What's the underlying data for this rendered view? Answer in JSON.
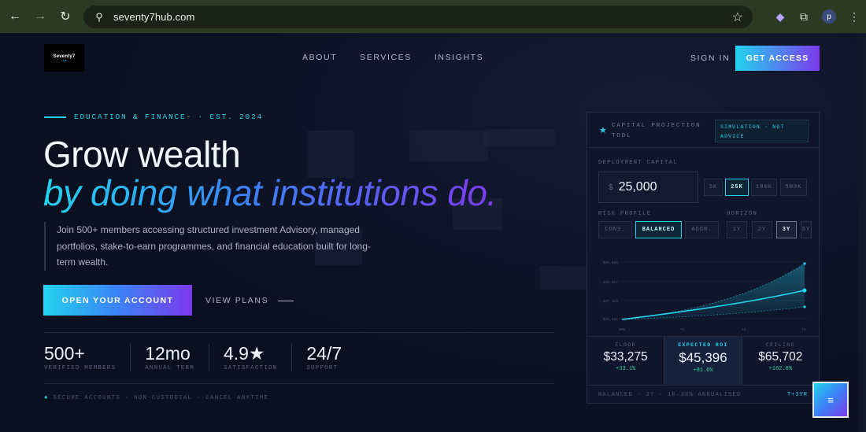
{
  "browser": {
    "url": "seventy7hub.com",
    "back_icon": "←",
    "forward_icon": "→",
    "reload_icon": "↻",
    "site_info_icon": "⚲",
    "bookmark_icon": "☆",
    "extension_icon": "◆",
    "puzzle_icon": "⧉",
    "profile_letter": "p",
    "menu_icon": "⋮"
  },
  "logo": {
    "text": "Seventy7",
    "sub": "HUB"
  },
  "nav": {
    "about": "ABOUT",
    "services": "SERVICES",
    "insights": "INSIGHTS",
    "sign_in": "SIGN IN",
    "get_access": "GET ACCESS"
  },
  "hero": {
    "eyebrow": "EDUCATION & FINANCE- · EST. 2024",
    "headline_1": "Grow wealth",
    "headline_2": "by doing what institutions do.",
    "lede": "Join 500+ members accessing structured investment Advisory, managed portfolios, stake-to-earn programmes, and financial education built for long-term wealth.",
    "cta": "OPEN YOUR ACCOUNT",
    "secondary": "VIEW PLANS"
  },
  "stats": [
    {
      "value": "500+",
      "label": "VERIFIED MEMBERS"
    },
    {
      "value": "12mo",
      "label": "ANNUAL TERM"
    },
    {
      "value": "4.9★",
      "label": "SATISFACTION"
    },
    {
      "value": "24/7",
      "label": "SUPPORT"
    }
  ],
  "footnote": "SECURE ACCOUNTS · NON-CUSTODIAL · CANCEL ANYTIME",
  "card": {
    "star": "★",
    "title": "CAPITAL PROJECTION TOOL",
    "badge": "SIMULATION · NOT ADVICE",
    "deployment_label": "DEPLOYMENT CAPITAL",
    "currency": "$",
    "capital": "25,000",
    "capital_chips": [
      "5K",
      "25K",
      "100K",
      "500K"
    ],
    "risk_label": "RISK PROFILE",
    "risk_chips": [
      "CONS.",
      "BALANCED",
      "AGGR."
    ],
    "horizon_label": "HORIZON",
    "horizon_chips": [
      "1Y",
      "2Y",
      "3Y",
      "5Y"
    ],
    "chart": {
      "y_ticks": [
        "$65,805",
        "$48,317",
        "$37,126",
        "$25,965"
      ],
      "x_ticks": [
        "NOW",
        "Y1",
        "Y2",
        "Y3"
      ]
    },
    "floor": {
      "label": "FLOOR",
      "value": "$33,275",
      "pct": "+33.1%"
    },
    "expected": {
      "label": "EXPECTED ROI",
      "value": "$45,396",
      "pct": "+81.6%"
    },
    "ceiling": {
      "label": "CEILING",
      "value": "$65,702",
      "pct": "+162.8%"
    },
    "foot_left": "BALANCED · 3Y · 10–30% ANNUALISED",
    "foot_right": "T+3YR"
  },
  "fab_icon": "≡",
  "colors": {
    "accent_cyan": "#22d3ee",
    "accent_violet": "#7c3aed",
    "background": "#0b1020",
    "positive": "#34d399"
  }
}
